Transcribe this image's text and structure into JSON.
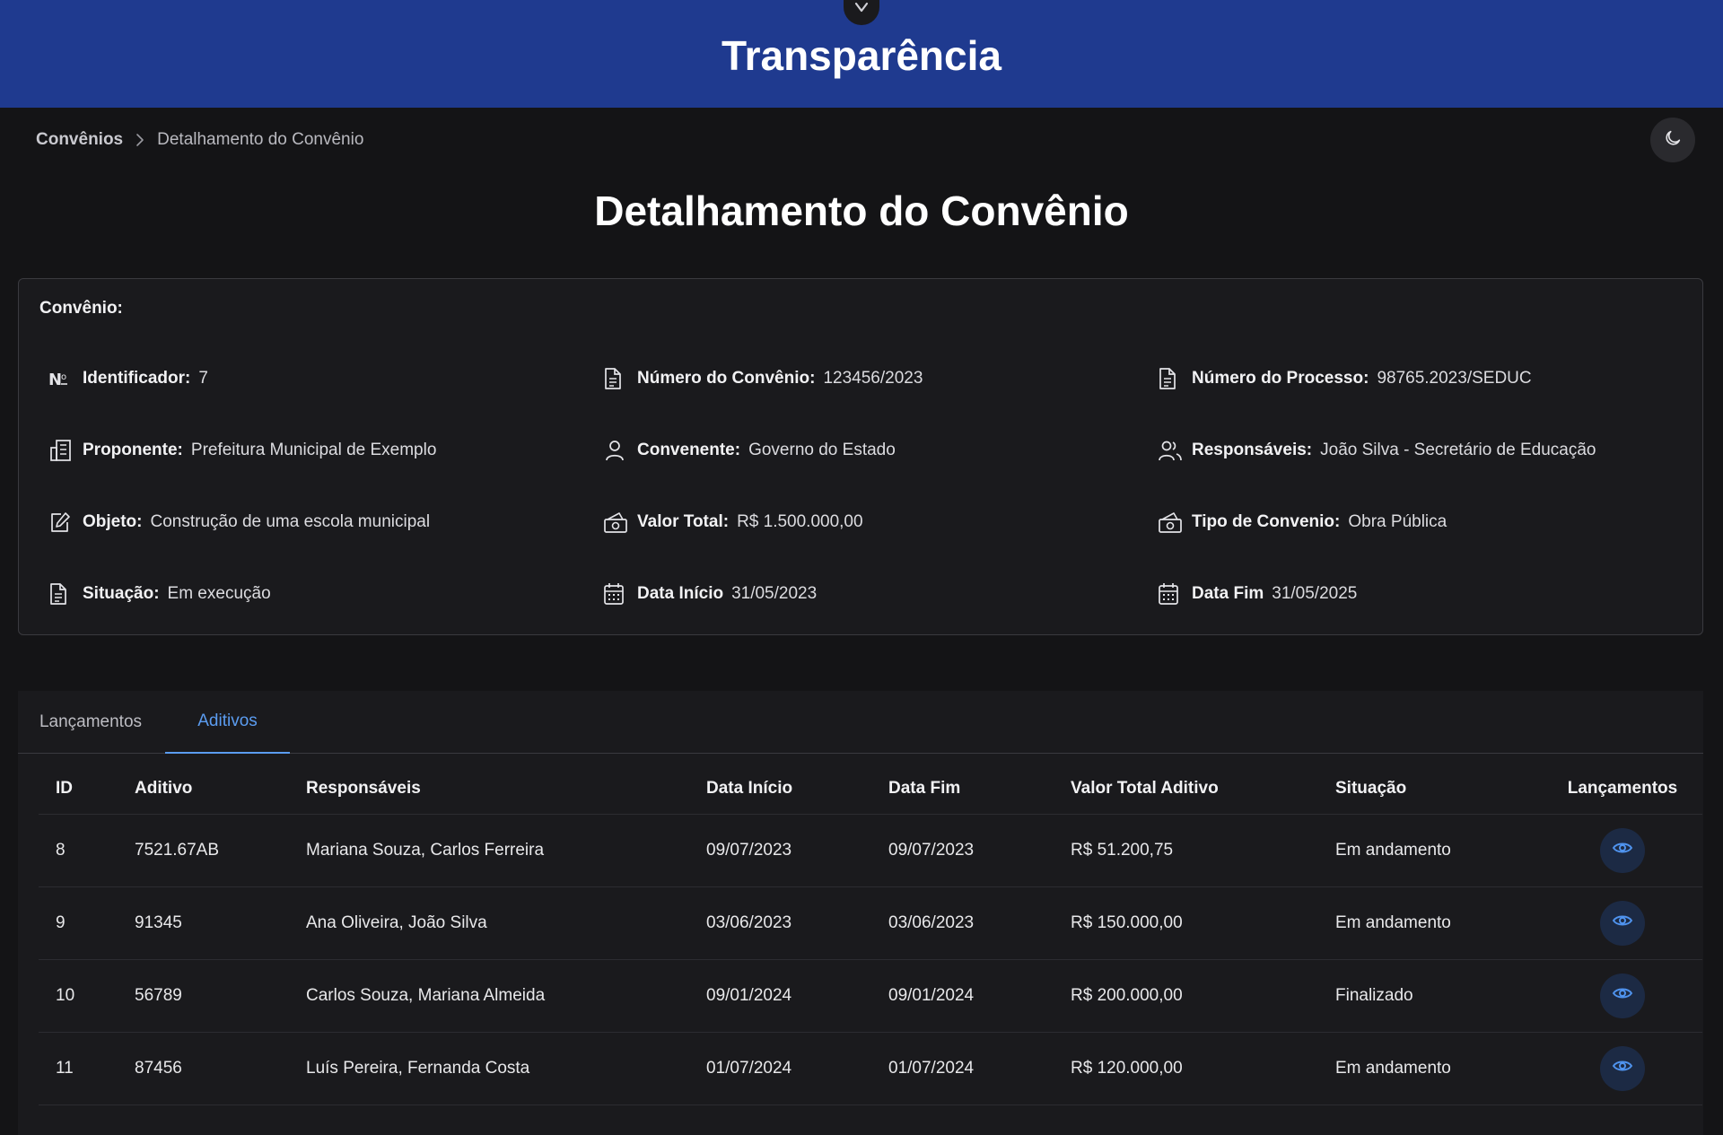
{
  "header": {
    "title": "Transparência",
    "toggle_icon": "chevron-down-icon",
    "background_color": "#1f3a8f"
  },
  "breadcrumb": {
    "root": "Convênios",
    "current": "Detalhamento do Convênio"
  },
  "theme_toggle": {
    "icon": "moon-icon"
  },
  "page_title": "Detalhamento do Convênio",
  "convenio": {
    "heading": "Convênio:",
    "fields": [
      {
        "icon": "number-sign-icon",
        "label": "Identificador:",
        "value": "7"
      },
      {
        "icon": "document-icon",
        "label": "Número do Convênio:",
        "value": "123456/2023"
      },
      {
        "icon": "document-icon",
        "label": "Número do Processo:",
        "value": "98765.2023/SEDUC"
      },
      {
        "icon": "building-icon",
        "label": "Proponente:",
        "value": "Prefeitura Municipal de Exemplo"
      },
      {
        "icon": "user-icon",
        "label": "Convenente:",
        "value": "Governo do Estado"
      },
      {
        "icon": "users-icon",
        "label": "Responsáveis:",
        "value": "João Silva - Secretário de Educação"
      },
      {
        "icon": "edit-icon",
        "label": "Objeto:",
        "value": "Construção de uma escola municipal"
      },
      {
        "icon": "money-icon",
        "label": "Valor Total:",
        "value": "R$ 1.500.000,00"
      },
      {
        "icon": "money-icon",
        "label": "Tipo de Convenio:",
        "value": "Obra Pública"
      },
      {
        "icon": "document-icon",
        "label": "Situação:",
        "value": "Em execução"
      },
      {
        "icon": "calendar-icon",
        "label": "Data Início",
        "value": "31/05/2023"
      },
      {
        "icon": "calendar-icon",
        "label": "Data Fim",
        "value": "31/05/2025"
      }
    ]
  },
  "tabs": [
    {
      "label": "Lançamentos",
      "active": false
    },
    {
      "label": "Aditivos",
      "active": true
    }
  ],
  "accent_color": "#5b9cf0",
  "table": {
    "headers": [
      "ID",
      "Aditivo",
      "Responsáveis",
      "Data Início",
      "Data Fim",
      "Valor Total Aditivo",
      "Situação",
      "Lançamentos"
    ],
    "rows": [
      [
        "8",
        "7521.67AB",
        "Mariana Souza, Carlos Ferreira",
        "09/07/2023",
        "09/07/2023",
        "R$ 51.200,75",
        "Em andamento"
      ],
      [
        "9",
        "91345",
        "Ana Oliveira, João Silva",
        "03/06/2023",
        "03/06/2023",
        "R$ 150.000,00",
        "Em andamento"
      ],
      [
        "10",
        "56789",
        "Carlos Souza, Mariana Almeida",
        "09/01/2024",
        "09/01/2024",
        "R$ 200.000,00",
        "Finalizado"
      ],
      [
        "11",
        "87456",
        "Luís Pereira, Fernanda Costa",
        "01/07/2024",
        "01/07/2024",
        "R$ 120.000,00",
        "Em andamento"
      ]
    ],
    "action_icon": "eye-icon"
  }
}
